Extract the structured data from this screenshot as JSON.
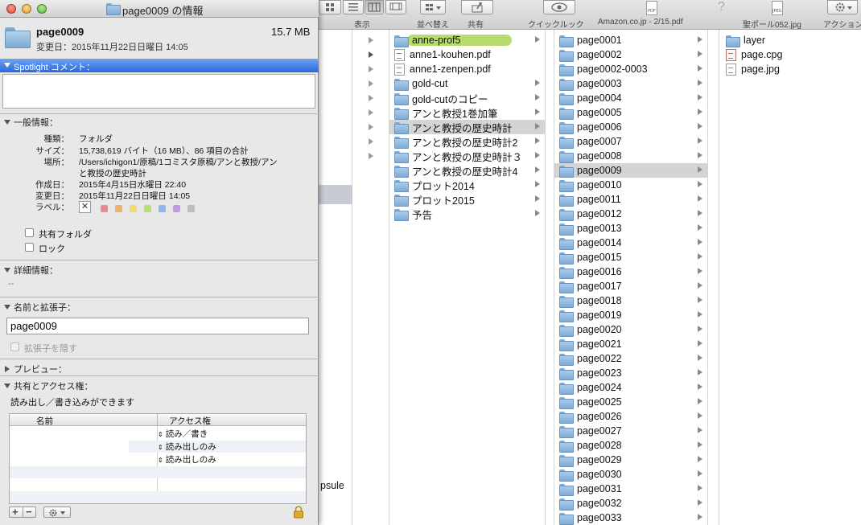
{
  "toolbar": {
    "view_label": "表示",
    "arrange_label": "並べ替え",
    "share_label": "共有",
    "quicklook_label": "クイックルック",
    "file1_label": "Amazon.co.jp - 2/15.pdf",
    "file2_label": "聖ポール052.jpg",
    "action_label": "アクション"
  },
  "column2": [
    {
      "name": "anne-prof5",
      "type": "folder",
      "tag": "green",
      "arrow": true
    },
    {
      "name": "anne1-kouhen.pdf",
      "type": "doc",
      "arrow": false
    },
    {
      "name": "anne1-zenpen.pdf",
      "type": "doc",
      "arrow": false
    },
    {
      "name": "gold-cut",
      "type": "folder",
      "arrow": true
    },
    {
      "name": "gold-cutのコピー",
      "type": "folder",
      "arrow": true
    },
    {
      "name": "アンと教授1巻加筆",
      "type": "folder",
      "arrow": true
    },
    {
      "name": "アンと教授の歴史時計",
      "type": "folder",
      "arrow": true,
      "selected": true
    },
    {
      "name": "アンと教授の歴史時計2",
      "type": "folder",
      "arrow": true
    },
    {
      "name": "アンと教授の歴史時計３",
      "type": "folder",
      "arrow": true
    },
    {
      "name": "アンと教授の歴史時計4",
      "type": "folder",
      "arrow": true
    },
    {
      "name": "プロット2014",
      "type": "folder",
      "arrow": true
    },
    {
      "name": "プロット2015",
      "type": "folder",
      "arrow": true
    },
    {
      "name": "予告",
      "type": "folder",
      "arrow": true
    }
  ],
  "column3": [
    "page0001",
    "page0002",
    "page0002-0003",
    "page0003",
    "page0004",
    "page0005",
    "page0006",
    "page0007",
    "page0008",
    "page0009",
    "page0010",
    "page0011",
    "page0012",
    "page0013",
    "page0014",
    "page0015",
    "page0016",
    "page0017",
    "page0018",
    "page0019",
    "page0020",
    "page0021",
    "page0022",
    "page0023",
    "page0024",
    "page0025",
    "page0026",
    "page0027",
    "page0028",
    "page0029",
    "page0030",
    "page0031",
    "page0032",
    "page0033"
  ],
  "column3_selected": "page0009",
  "column4": [
    {
      "name": "layer",
      "type": "folder"
    },
    {
      "name": "page.cpg",
      "type": "doc-red"
    },
    {
      "name": "page.jpg",
      "type": "doc"
    }
  ],
  "bg_partial_text": "psule",
  "info": {
    "window_title": "page0009 の情報",
    "name": "page0009",
    "size": "15.7 MB",
    "modified_line": "変更日：2015年11月22日日曜日 14:05",
    "spotlight_header": "Spotlight コメント：",
    "general_header": "一般情報：",
    "kind_key": "種類：",
    "kind_val": "フォルダ",
    "size_key": "サイズ：",
    "size_val": "15,738,619 バイト（16 MB）、86 項目の合計",
    "where_key": "場所：",
    "where_val1": "/Users/ichigon1/原稿/1コミスタ原稿/アンと教授/アン",
    "where_val2": "と教授の歴史時計",
    "created_key": "作成日：",
    "created_val": "2015年4月15日水曜日 22:40",
    "modified_key": "変更日：",
    "modified_val": "2015年11月22日日曜日 14:05",
    "label_key": "ラベル：",
    "shared_folder": "共有フォルダ",
    "locked": "ロック",
    "more_info_header": "詳細情報：",
    "more_info_val": "--",
    "name_ext_header": "名前と拡張子：",
    "name_field_value": "page0009",
    "hide_ext": "拡張子を隠す",
    "preview_header": "プレビュー：",
    "sharing_header": "共有とアクセス権：",
    "sharing_status": "読み出し／書き込みができます",
    "perm_col_name": "名前",
    "perm_col_access": "アクセス権",
    "permissions": [
      "読み／書き",
      "読み出しのみ",
      "読み出しのみ"
    ],
    "label_colors": [
      "#e88a8a",
      "#f0b070",
      "#eedd70",
      "#b8de78",
      "#8ab8ee",
      "#c49ae0",
      "#bdbdbd"
    ]
  }
}
